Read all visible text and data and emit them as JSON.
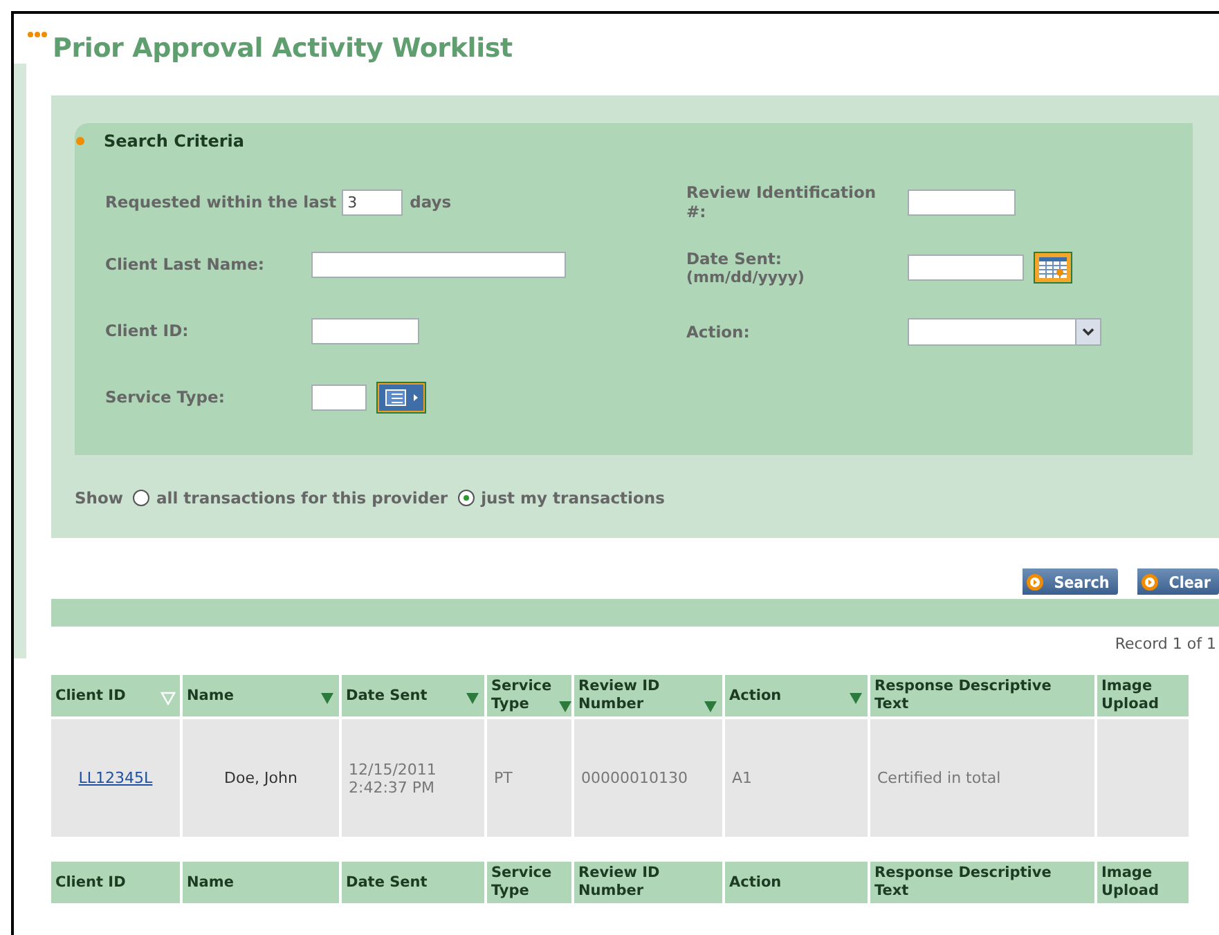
{
  "page_title": "Prior Approval Activity Worklist",
  "search_criteria": {
    "title": "Search Criteria",
    "left_fields": [
      {
        "kind": "inline",
        "label": "Requested within the last",
        "value": "3",
        "suffix": "days"
      },
      {
        "kind": "long-text",
        "label": "Client Last Name:"
      },
      {
        "kind": "text",
        "label": "Client ID:"
      },
      {
        "kind": "lookup",
        "label": "Service Type:"
      }
    ],
    "right_fields": [
      {
        "kind": "text",
        "label": "Review Identification #:"
      },
      {
        "kind": "date",
        "label": "Date Sent:",
        "hint": "(mm/dd/yyyy)"
      },
      {
        "kind": "select",
        "label": "Action:"
      }
    ]
  },
  "show": {
    "label": "Show",
    "options": [
      {
        "label": "all transactions for this provider",
        "selected": false
      },
      {
        "label": "just my transactions",
        "selected": true
      }
    ]
  },
  "buttons": [
    "Search",
    "Clear"
  ],
  "record_count": "Record 1 of 1",
  "table": {
    "columns": [
      {
        "label": "Client ID",
        "sorted": true
      },
      {
        "label": "Name",
        "sorted": false
      },
      {
        "label": "Date Sent",
        "sorted": false
      },
      {
        "label": "Service Type",
        "sorted": false
      },
      {
        "label": "Review ID Number",
        "sorted": false
      },
      {
        "label": "Action",
        "sorted": false
      },
      {
        "label": "Response Descriptive Text"
      },
      {
        "label": "Image Upload"
      }
    ],
    "rows": [
      {
        "client_id": "LL12345L",
        "name": "Doe, John",
        "date_sent": "12/15/2011 2:42:37 PM",
        "service_type": "PT",
        "review_id": "00000010130",
        "action": "A1",
        "response": "Certified in total"
      }
    ],
    "footer_columns": [
      "Client ID",
      "Name",
      "Date Sent",
      "Service Type",
      "Review ID Number",
      "Action",
      "Response Descriptive Text",
      "Image Upload"
    ]
  }
}
